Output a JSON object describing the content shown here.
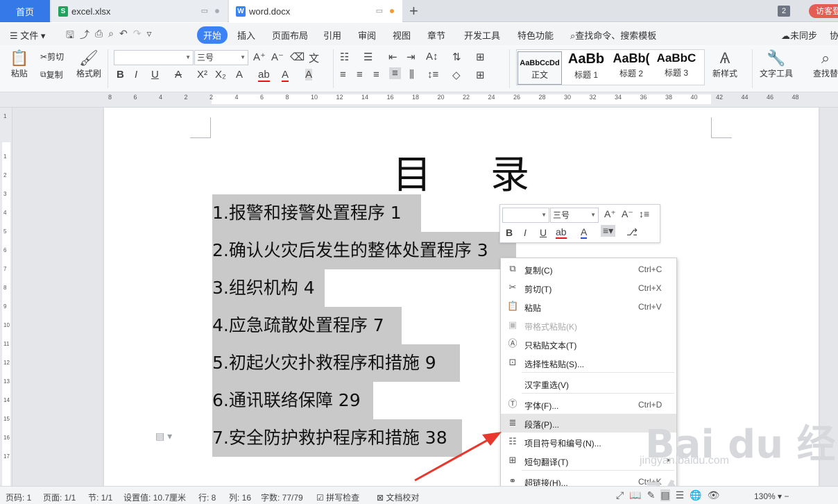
{
  "tabs": {
    "home": "首页",
    "excel": "excel.xlsx",
    "word": "word.docx",
    "window_count": "2",
    "visitor": "访客登"
  },
  "menu": {
    "file": "文件",
    "start": "开始",
    "insert": "插入",
    "layout": "页面布局",
    "references": "引用",
    "review": "审阅",
    "view": "视图",
    "chapter": "章节",
    "dev_tools": "开发工具",
    "features": "特色功能",
    "search": "查找命令、搜索模板",
    "sync": "未同步",
    "share": "协"
  },
  "ribbon": {
    "paste": "粘贴",
    "cut": "剪切",
    "copy": "复制",
    "format_painter": "格式刷",
    "font_name": "",
    "font_size": "三号",
    "styles": [
      {
        "preview": "AaBbCcDd",
        "label": "正文"
      },
      {
        "preview": "AaBb",
        "label": "标题 1"
      },
      {
        "preview": "AaBb(",
        "label": "标题 2"
      },
      {
        "preview": "AaBbC",
        "label": "标题 3"
      }
    ],
    "new_style": "新样式",
    "text_tools": "文字工具",
    "find_replace": "查找替"
  },
  "ruler_numbers": [
    "8",
    "6",
    "4",
    "2",
    "2",
    "4",
    "6",
    "8",
    "10",
    "12",
    "14",
    "16",
    "18",
    "20",
    "22",
    "24",
    "26",
    "28",
    "30",
    "32",
    "34",
    "36",
    "38",
    "40",
    "42",
    "44",
    "46",
    "48"
  ],
  "vruler_numbers": [
    "1",
    "1",
    "2",
    "3",
    "4",
    "5",
    "6",
    "7",
    "8",
    "9",
    "10",
    "11",
    "12",
    "13",
    "14",
    "15",
    "16",
    "17"
  ],
  "document": {
    "title": "目录",
    "toc": [
      "1.报警和接警处置程序 1",
      "2.确认火灾后发生的整体处置程序 3",
      "3.组织机构 4",
      "4.应急疏散处置程序 7",
      "5.初起火灾扑救程序和措施 9",
      "6.通讯联络保障 29",
      "7.安全防护救护程序和措施 38"
    ]
  },
  "minibar": {
    "font_name": "",
    "font_size": "三号"
  },
  "context_menu": [
    {
      "label": "复制(C)",
      "shortcut": "Ctrl+C",
      "icon": "copy-icon",
      "disabled": false
    },
    {
      "label": "剪切(T)",
      "shortcut": "Ctrl+X",
      "icon": "scissors-icon",
      "disabled": false
    },
    {
      "label": "粘贴",
      "shortcut": "Ctrl+V",
      "icon": "paste-icon",
      "disabled": false
    },
    {
      "label": "带格式粘贴(K)",
      "shortcut": "",
      "icon": "paste-format-icon",
      "disabled": true
    },
    {
      "label": "只粘贴文本(T)",
      "shortcut": "",
      "icon": "paste-text-icon",
      "disabled": false
    },
    {
      "label": "选择性粘贴(S)...",
      "shortcut": "",
      "icon": "paste-special-icon",
      "disabled": false
    },
    {
      "label": "汉字重选(V)",
      "shortcut": "",
      "icon": "",
      "disabled": false
    },
    {
      "label": "字体(F)...",
      "shortcut": "Ctrl+D",
      "icon": "font-icon",
      "disabled": false
    },
    {
      "label": "段落(P)...",
      "shortcut": "",
      "icon": "paragraph-icon",
      "disabled": false
    },
    {
      "label": "项目符号和编号(N)...",
      "shortcut": "",
      "icon": "bullets-icon",
      "disabled": false
    },
    {
      "label": "短句翻译(T)",
      "shortcut": "",
      "icon": "translate-icon",
      "disabled": false
    },
    {
      "label": "超链接(H)...",
      "shortcut": "Ctrl+K",
      "icon": "link-icon",
      "disabled": false
    }
  ],
  "status": {
    "page": "页码: 1",
    "pages": "页面: 1/1",
    "section": "节: 1/1",
    "setting": "设置值: 10.7厘米",
    "row": "行: 8",
    "col": "列: 16",
    "words": "字数: 77/79",
    "spell": "拼写检查",
    "proof": "文档校对",
    "zoom": "130%"
  },
  "watermark": {
    "main": "Bai du 经验",
    "sub": "jingyan.baidu.com"
  },
  "colors": {
    "accent": "#3b82f6",
    "home_tab": "#3579e8",
    "visitor": "#e45c52",
    "selection": "#c9c9c9",
    "arrow": "#e8372c"
  }
}
